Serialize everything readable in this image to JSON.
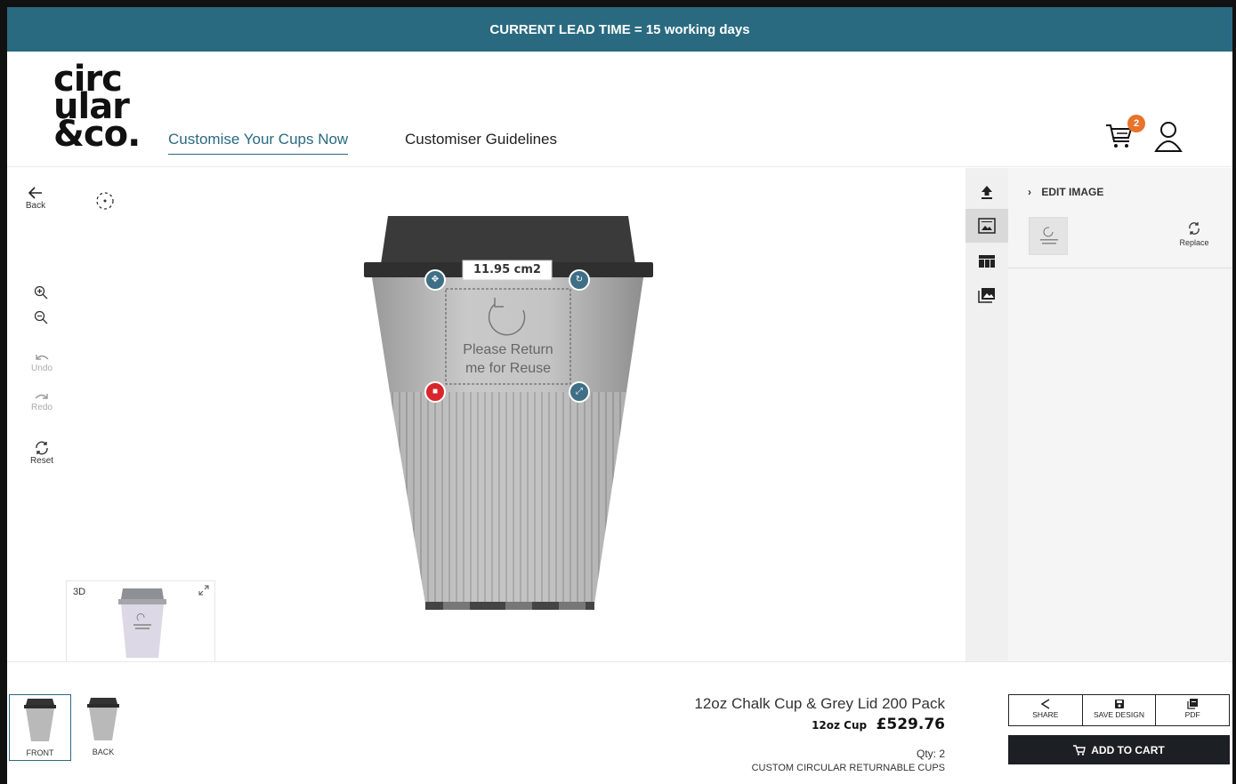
{
  "banner": {
    "text": "CURRENT LEAD TIME = 15 working days"
  },
  "header": {
    "logo": [
      "circ",
      "ular",
      "&co."
    ],
    "nav": [
      {
        "label": "Customise Your Cups Now",
        "active": true
      },
      {
        "label": "Customiser Guidelines",
        "active": false
      }
    ],
    "cart_count": "2"
  },
  "left_toolbar": {
    "back_label": "Back",
    "undo_label": "Undo",
    "redo_label": "Redo",
    "reset_label": "Reset"
  },
  "canvas": {
    "dimension_label": "11.95 cm2",
    "logo_text_line1": "Please Return",
    "logo_text_line2": "me for Reuse"
  },
  "preview3d": {
    "label": "3D"
  },
  "right_panel": {
    "title": "EDIT IMAGE",
    "replace_label": "Replace"
  },
  "sides": [
    {
      "label": "FRONT",
      "active": true
    },
    {
      "label": "BACK",
      "active": false
    }
  ],
  "product": {
    "name": "12oz Chalk Cup & Grey Lid 200 Pack",
    "size": "12oz Cup",
    "price": "£529.76",
    "qty": "Qty: 2",
    "type": "CUSTOM CIRCULAR RETURNABLE CUPS"
  },
  "actions": {
    "share": "SHARE",
    "save": "SAVE DESIGN",
    "pdf": "PDF",
    "add_to_cart": "ADD TO CART"
  },
  "colors": {
    "brand": "#2a6a80",
    "badge": "#e8732b",
    "delete": "#d9252b",
    "dark": "#1c1f24"
  }
}
